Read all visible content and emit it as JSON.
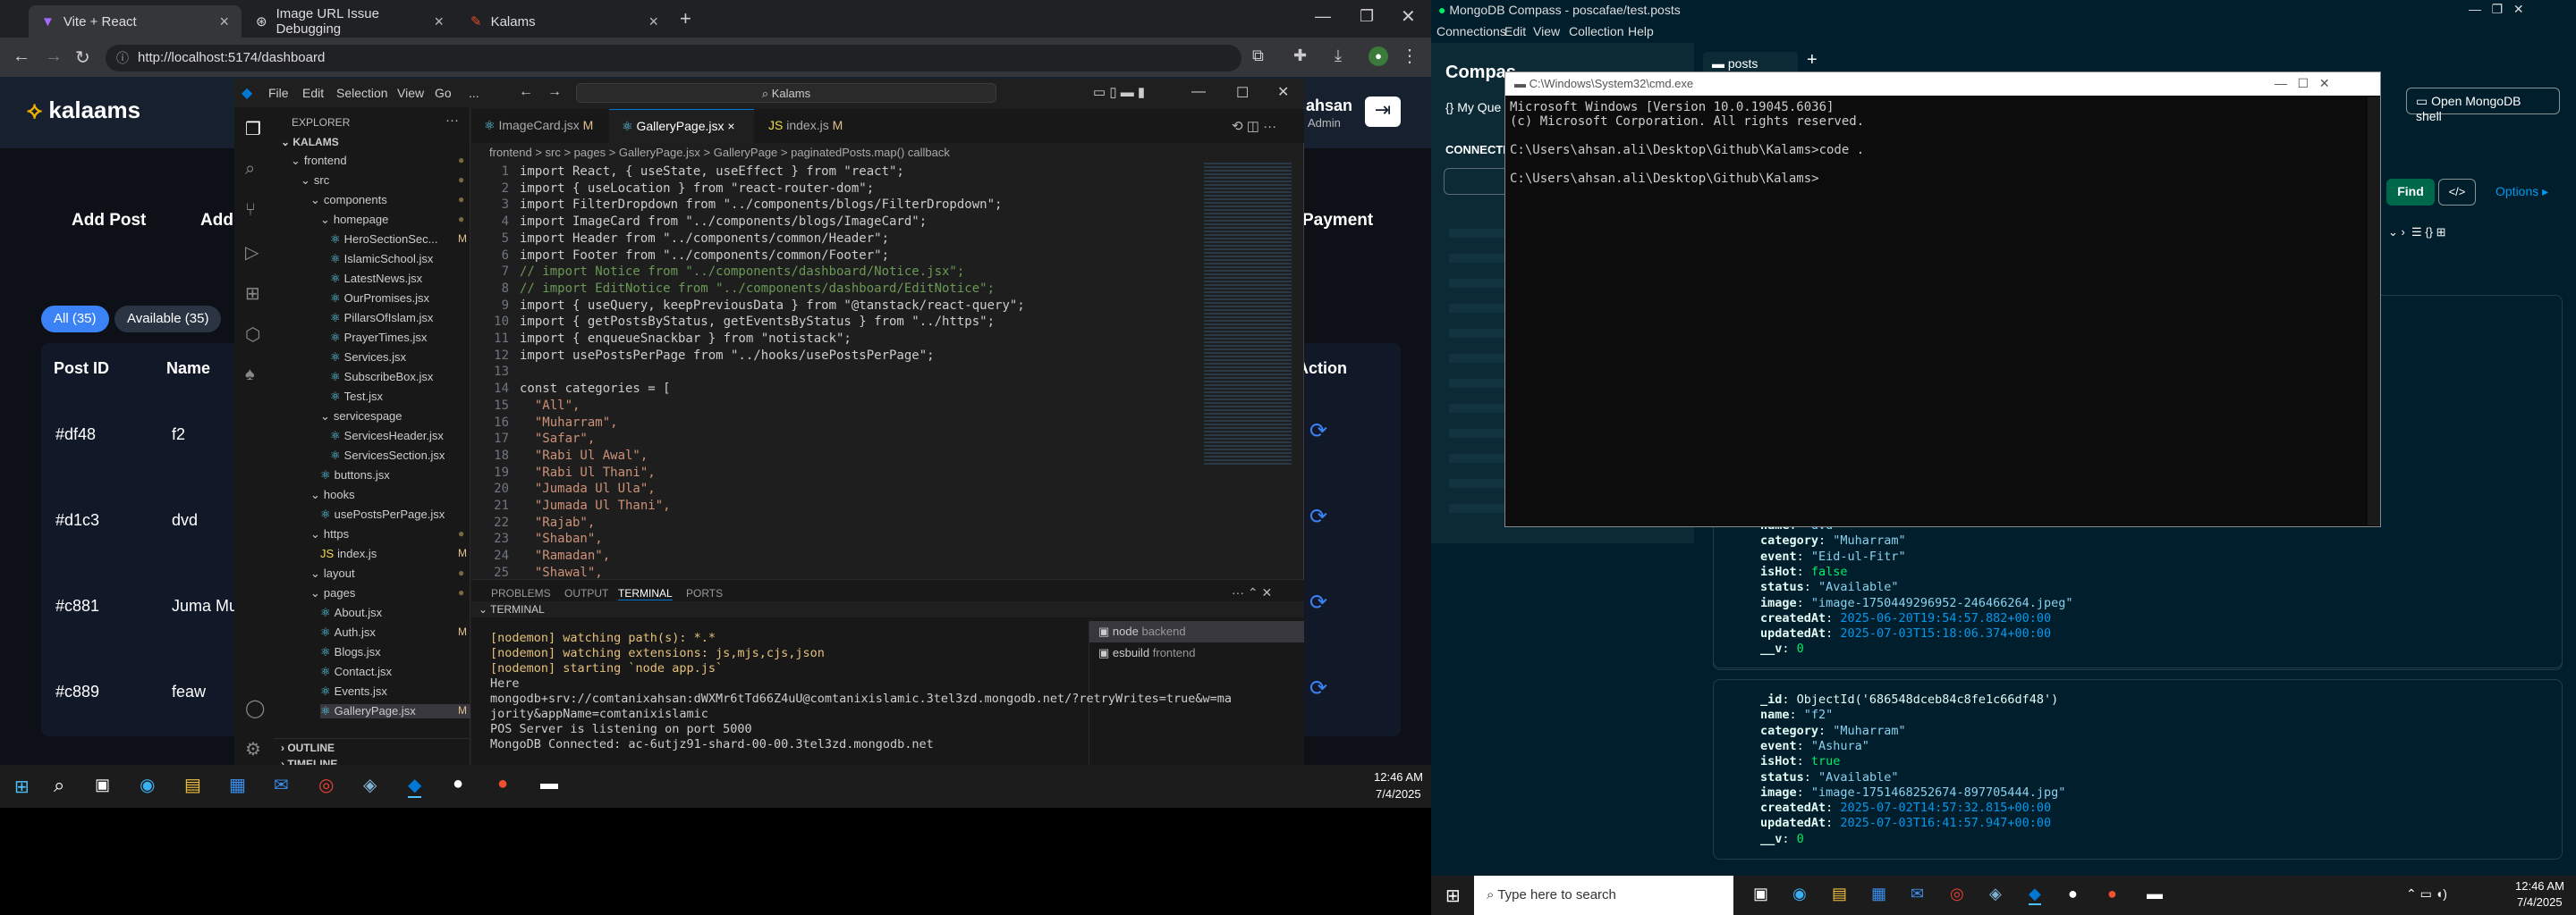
{
  "chrome": {
    "tabs": [
      {
        "label": "Vite + React"
      },
      {
        "label": "Image URL Issue Debugging"
      },
      {
        "label": "Kalams"
      }
    ],
    "url": "http://localhost:5174/dashboard",
    "new_tab": "+"
  },
  "app": {
    "logo": "kalaams",
    "user": "ahsan",
    "role": "Admin",
    "buttons": [
      "Add Post",
      "Add"
    ],
    "payment": "Payment",
    "filters": [
      "All (35)",
      "Available (35)"
    ],
    "headers": [
      "Post ID",
      "Name",
      "Action"
    ],
    "rows": [
      {
        "id": "#df48",
        "name": "f2"
      },
      {
        "id": "#d1c3",
        "name": "dvd"
      },
      {
        "id": "#c881",
        "name": "Juma Mu"
      },
      {
        "id": "#c889",
        "name": "feaw"
      }
    ]
  },
  "vscode": {
    "menu": [
      "File",
      "Edit",
      "Selection",
      "View",
      "Go",
      "..."
    ],
    "search": "Kalams",
    "explorer": "EXPLORER",
    "root": "KALAMS",
    "tree": [
      {
        "l": "frontend",
        "d": 1,
        "t": "f",
        "m": "dot"
      },
      {
        "l": "src",
        "d": 2,
        "t": "f",
        "m": "dot"
      },
      {
        "l": "components",
        "d": 3,
        "t": "f",
        "m": "dot"
      },
      {
        "l": "homepage",
        "d": 4,
        "t": "f",
        "m": "dot"
      },
      {
        "l": "HeroSectionSec...",
        "d": 5,
        "t": "j",
        "m": "M"
      },
      {
        "l": "IslamicSchool.jsx",
        "d": 5,
        "t": "j",
        "m": ""
      },
      {
        "l": "LatestNews.jsx",
        "d": 5,
        "t": "j",
        "m": ""
      },
      {
        "l": "OurPromises.jsx",
        "d": 5,
        "t": "j",
        "m": ""
      },
      {
        "l": "PillarsOfIslam.jsx",
        "d": 5,
        "t": "j",
        "m": ""
      },
      {
        "l": "PrayerTimes.jsx",
        "d": 5,
        "t": "j",
        "m": ""
      },
      {
        "l": "Services.jsx",
        "d": 5,
        "t": "j",
        "m": ""
      },
      {
        "l": "SubscribeBox.jsx",
        "d": 5,
        "t": "j",
        "m": ""
      },
      {
        "l": "Test.jsx",
        "d": 5,
        "t": "j",
        "m": ""
      },
      {
        "l": "servicespage",
        "d": 4,
        "t": "f",
        "m": ""
      },
      {
        "l": "ServicesHeader.jsx",
        "d": 5,
        "t": "j",
        "m": ""
      },
      {
        "l": "ServicesSection.jsx",
        "d": 5,
        "t": "j",
        "m": ""
      },
      {
        "l": "buttons.jsx",
        "d": 4,
        "t": "j",
        "m": ""
      },
      {
        "l": "hooks",
        "d": 3,
        "t": "f",
        "m": ""
      },
      {
        "l": "usePostsPerPage.jsx",
        "d": 4,
        "t": "j",
        "m": ""
      },
      {
        "l": "https",
        "d": 3,
        "t": "f",
        "m": "dot"
      },
      {
        "l": "index.js",
        "d": 4,
        "t": "s",
        "m": "M"
      },
      {
        "l": "layout",
        "d": 3,
        "t": "f",
        "m": "dot"
      },
      {
        "l": "pages",
        "d": 3,
        "t": "f",
        "m": "dot"
      },
      {
        "l": "About.jsx",
        "d": 4,
        "t": "j",
        "m": ""
      },
      {
        "l": "Auth.jsx",
        "d": 4,
        "t": "j",
        "m": "M"
      },
      {
        "l": "Blogs.jsx",
        "d": 4,
        "t": "j",
        "m": ""
      },
      {
        "l": "Contact.jsx",
        "d": 4,
        "t": "j",
        "m": ""
      },
      {
        "l": "Events.jsx",
        "d": 4,
        "t": "j",
        "m": ""
      },
      {
        "l": "GalleryPage.jsx",
        "d": 4,
        "t": "j",
        "m": "M"
      }
    ],
    "outline": "OUTLINE",
    "timeline": "TIMELINE",
    "tabs": [
      {
        "l": "ImageCard.jsx",
        "m": "M"
      },
      {
        "l": "GalleryPage.jsx",
        "m": "M"
      },
      {
        "l": "index.js",
        "m": "M"
      }
    ],
    "breadcrumbs": "frontend > src > pages > GalleryPage.jsx > GalleryPage > paginatedPosts.map() callback",
    "code": [
      "import React, { useState, useEffect } from \"react\";",
      "import { useLocation } from \"react-router-dom\";",
      "import FilterDropdown from \"../components/blogs/FilterDropdown\";",
      "import ImageCard from \"../components/blogs/ImageCard\";",
      "import Header from \"../components/common/Header\";",
      "import Footer from \"../components/common/Footer\";",
      "// import Notice from \"../components/dashboard/Notice.jsx\";",
      "// import EditNotice from \"../components/dashboard/EditNotice\";",
      "import { useQuery, keepPreviousData } from \"@tanstack/react-query\";",
      "import { getPostsByStatus, getEventsByStatus } from \"../https\";",
      "import { enqueueSnackbar } from \"notistack\";",
      "import usePostsPerPage from \"../hooks/usePostsPerPage\";",
      "",
      "const categories = [",
      "  \"All\",",
      "  \"Muharram\",",
      "  \"Safar\",",
      "  \"Rabi Ul Awal\",",
      "  \"Rabi Ul Thani\",",
      "  \"Jumada Ul Ula\",",
      "  \"Jumada Ul Thani\",",
      "  \"Rajab\",",
      "  \"Shaban\",",
      "  \"Ramadan\",",
      "  \"Shawal\","
    ],
    "panel_tabs": [
      "PROBLEMS",
      "OUTPUT",
      "TERMINAL",
      "PORTS"
    ],
    "terminal_label": "TERMINAL",
    "terminal": [
      "[nodemon] watching path(s): *.*",
      "[nodemon] watching extensions: js,mjs,cjs,json",
      "[nodemon] starting `node app.js`",
      "Here",
      "mongodb+srv://comtanixahsan:dWXMr6tTd66Z4uU@comtanixislamic.3tel3zd.mongodb.net/?retryWrites=true&w=ma",
      "jority&appName=comtanixislamic",
      "POS Server is listening on port 5000",
      "MongoDB Connected: ac-6utjz91-shard-00-00.3tel3zd.mongodb.net"
    ],
    "terminals": [
      {
        "name": "node",
        "desc": "backend"
      },
      {
        "name": "esbuild",
        "desc": "frontend"
      }
    ]
  },
  "taskbar_left": {
    "time": "12:46 AM",
    "date": "7/4/2025"
  },
  "mongo": {
    "title": "MongoDB Compass - poscafae/test.posts",
    "menu": [
      "Connections",
      "Edit",
      "View",
      "Collection",
      "Help"
    ],
    "tab": "posts",
    "sidebar_title": "Compas",
    "my_queries": "My Que",
    "connections": "CONNECTI",
    "open_shell": "Open MongoDB shell",
    "find": "Find",
    "options": "Options ▸",
    "docs": [
      {
        "fields": [
          [
            "name",
            "\"dvd\""
          ],
          [
            "category",
            "\"Muharram\""
          ],
          [
            "event",
            "\"Eid-ul-Fitr\""
          ],
          [
            "isHot",
            "false"
          ],
          [
            "status",
            "\"Available\""
          ],
          [
            "image",
            "\"image-1750449296952-246466264.jpeg\""
          ],
          [
            "createdAt",
            "2025-06-20T19:54:57.882+00:00"
          ],
          [
            "updatedAt",
            "2025-07-03T15:18:06.374+00:00"
          ],
          [
            "__v",
            "0"
          ]
        ]
      },
      {
        "fields": [
          [
            "_id",
            "ObjectId('686548dceb84c8fe1c66df48')"
          ],
          [
            "name",
            "\"f2\""
          ],
          [
            "category",
            "\"Muharram\""
          ],
          [
            "event",
            "\"Ashura\""
          ],
          [
            "isHot",
            "true"
          ],
          [
            "status",
            "\"Available\""
          ],
          [
            "image",
            "\"image-1751468252674-897705444.jpg\""
          ],
          [
            "createdAt",
            "2025-07-02T14:57:32.815+00:00"
          ],
          [
            "updatedAt",
            "2025-07-03T16:41:57.947+00:00"
          ],
          [
            "__v",
            "0"
          ]
        ]
      }
    ]
  },
  "cmd": {
    "title": "C:\\Windows\\System32\\cmd.exe",
    "lines": [
      "Microsoft Windows [Version 10.0.19045.6036]",
      "(c) Microsoft Corporation. All rights reserved.",
      "",
      "C:\\Users\\ahsan.ali\\Desktop\\Github\\Kalams>code .",
      "",
      "C:\\Users\\ahsan.ali\\Desktop\\Github\\Kalams>"
    ]
  },
  "taskbar_right": {
    "search": "Type here to search",
    "time": "12:46 AM",
    "date": "7/4/2025"
  }
}
